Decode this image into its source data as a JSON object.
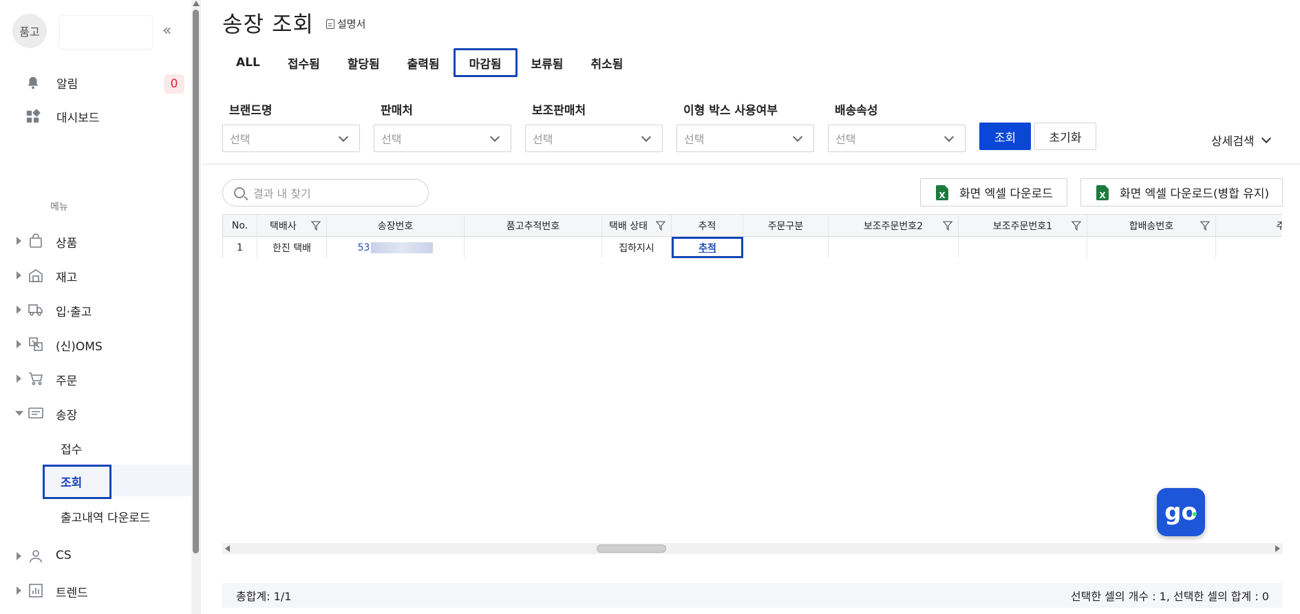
{
  "sidebar": {
    "logo_text": "품고",
    "alerts": {
      "label": "알림",
      "count": "0"
    },
    "dashboard": {
      "label": "대시보드"
    },
    "menu_title": "메뉴",
    "tree": [
      {
        "label": "상품",
        "icon": "bag-icon"
      },
      {
        "label": "재고",
        "icon": "warehouse-icon"
      },
      {
        "label": "입·출고",
        "icon": "truck-icon"
      },
      {
        "label": "(신)OMS",
        "icon": "oms-icon"
      },
      {
        "label": "주문",
        "icon": "cart-icon"
      },
      {
        "label": "송장",
        "icon": "invoice-icon"
      },
      {
        "label": "CS",
        "icon": "user-icon"
      },
      {
        "label": "트렌드",
        "icon": "chart-icon"
      }
    ],
    "sub_items": [
      {
        "label": "접수"
      },
      {
        "label": "조회"
      },
      {
        "label": "출고내역 다운로드"
      }
    ]
  },
  "header": {
    "title": "송장 조회",
    "help_label": "설명서"
  },
  "tabs": [
    {
      "label": "ALL"
    },
    {
      "label": "접수됨"
    },
    {
      "label": "할당됨"
    },
    {
      "label": "출력됨"
    },
    {
      "label": "마감됨"
    },
    {
      "label": "보류됨"
    },
    {
      "label": "취소됨"
    }
  ],
  "filters": [
    {
      "label": "브랜드명",
      "value": "선택"
    },
    {
      "label": "판매처",
      "value": "선택"
    },
    {
      "label": "보조판매처",
      "value": "선택"
    },
    {
      "label": "이형 박스 사용여부",
      "value": "선택"
    },
    {
      "label": "배송속성",
      "value": "선택"
    }
  ],
  "buttons": {
    "search": "조회",
    "reset": "초기화",
    "advanced": "상세검색",
    "excel_download": "화면 엑셀 다운로드",
    "excel_download_merge": "화면 엑셀 다운로드(병합 유지)",
    "excel_icon_text": "X"
  },
  "result_search": {
    "placeholder": "결과 내 찾기"
  },
  "table": {
    "columns": [
      "No.",
      "택배사",
      "송장번호",
      "품고추적번호",
      "택배 상태",
      "추적",
      "주문구분",
      "보조주문번호2",
      "보조주문번호1",
      "합배송번호",
      "주문번호"
    ],
    "rows": [
      {
        "no": "1",
        "courier": "한진 택배",
        "invoice_prefix": "53",
        "tracking_no": "",
        "status": "집하지시",
        "track": "추적",
        "order_type": "",
        "sub_order2": "",
        "sub_order1": "",
        "combined_no": "",
        "order_no": ""
      }
    ]
  },
  "footer": {
    "total": "총합계: 1/1",
    "selection": "선택한 셀의 개수 : 1, 선택한 셀의 합계 : 0"
  },
  "fab": {
    "label": "go"
  },
  "colors": {
    "accent": "#0a47d6",
    "highlight": "#1446b5",
    "badge": "#e0213c",
    "excel": "#1d7a3f"
  }
}
